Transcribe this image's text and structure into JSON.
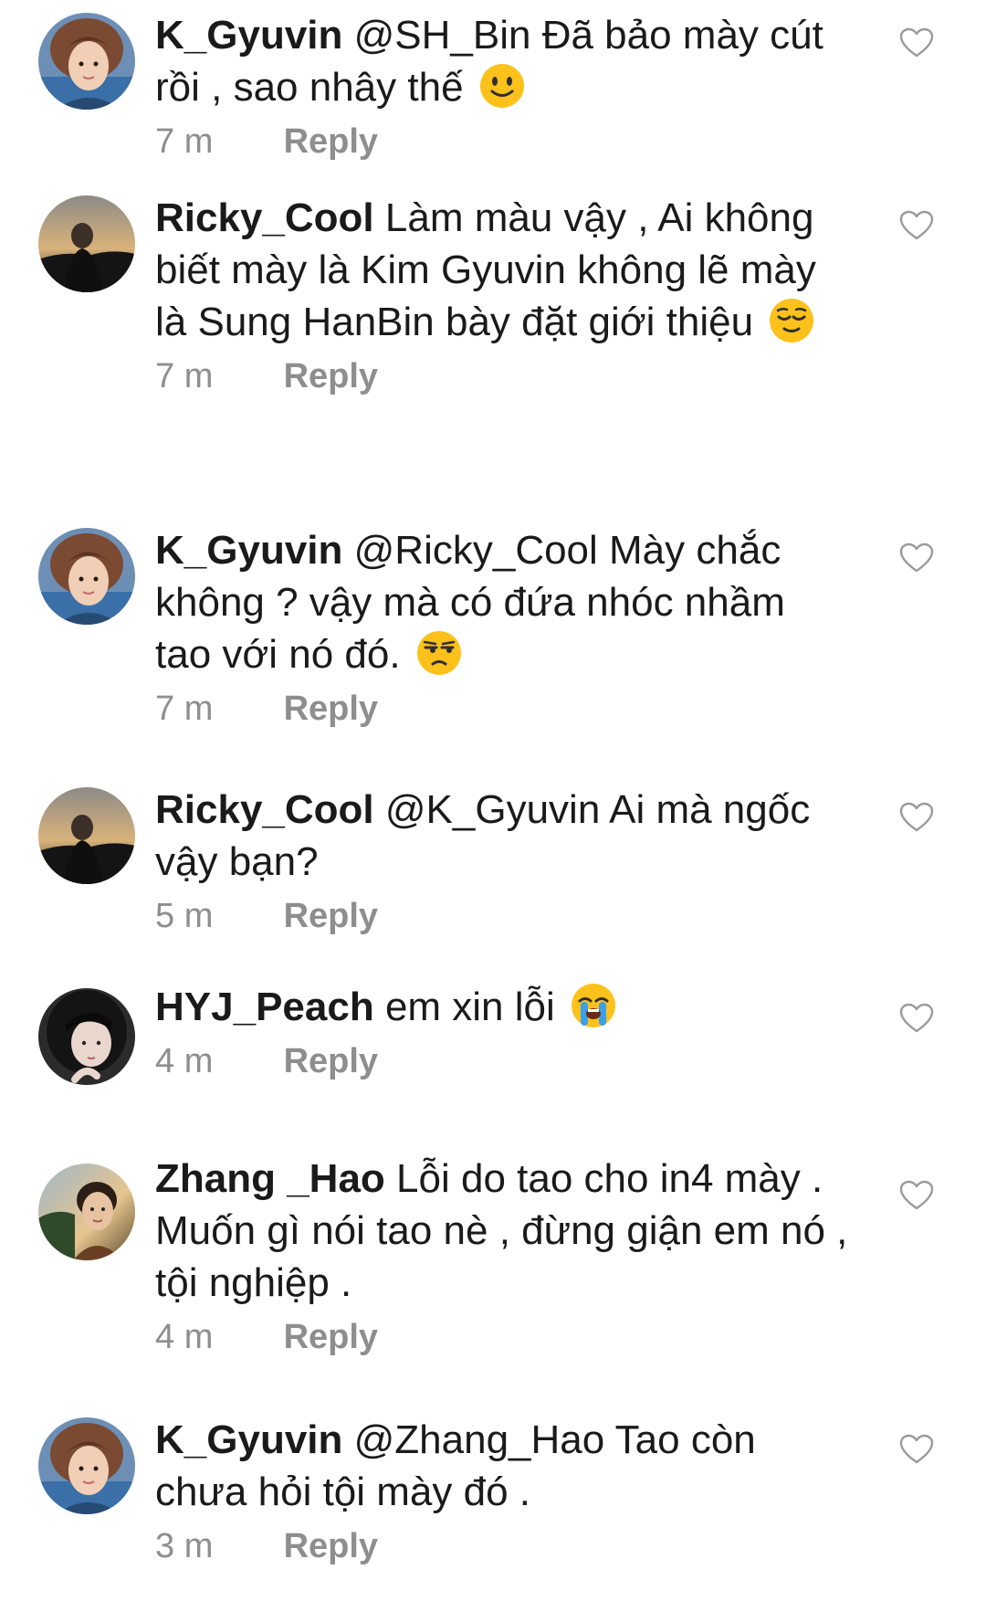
{
  "reply_label": "Reply",
  "colors": {
    "username": "#1a1a1a",
    "text": "#1a1a1a",
    "meta": "#8e8e8e",
    "heart_outline": "#9a9a9a",
    "emoji_yellow": "#fcc21b"
  },
  "comments": [
    {
      "username": "K_Gyuvin",
      "text": "@SH_Bin Đã bảo mày cút rồi , sao nhây thế",
      "emoji": "slightly-smiling-face",
      "time": "7 m",
      "avatar": "k-gyuvin-avatar"
    },
    {
      "username": "Ricky_Cool",
      "text": "Làm màu vậy , Ai không biết mày là Kim Gyuvin không lẽ mày là Sung HanBin bày đặt giới thiệu",
      "emoji": "relieved-face",
      "time": "7 m",
      "avatar": "ricky-cool-avatar"
    },
    {
      "username": "K_Gyuvin",
      "text": "@Ricky_Cool Mày chắc không ? vậy mà có đứa nhóc nhầm tao với nó đó.",
      "emoji": "unamused-face",
      "time": "7 m",
      "avatar": "k-gyuvin-avatar"
    },
    {
      "username": "Ricky_Cool",
      "text": "@K_Gyuvin Ai mà ngốc vậy bạn?",
      "emoji": "",
      "time": "5 m",
      "avatar": "ricky-cool-avatar"
    },
    {
      "username": "HYJ_Peach",
      "text": "em xin lỗi",
      "emoji": "loudly-crying-face",
      "time": "4 m",
      "avatar": "hyj-peach-avatar"
    },
    {
      "username": "Zhang _Hao",
      "text": "Lỗi do tao cho in4 mày . Muốn gì nói tao nè , đừng giận em nó , tội nghiệp .",
      "emoji": "",
      "time": "4 m",
      "avatar": "zhang-hao-avatar"
    },
    {
      "username": "K_Gyuvin",
      "text": "@Zhang_Hao Tao còn chưa hỏi tội mày đó .",
      "emoji": "",
      "time": "3 m",
      "avatar": "k-gyuvin-avatar"
    }
  ]
}
